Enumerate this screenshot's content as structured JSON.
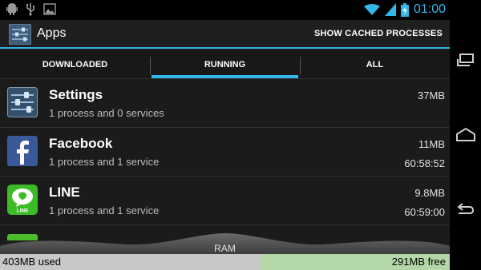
{
  "status_bar": {
    "time": "01:00",
    "icons": [
      "android-debug-icon",
      "usb-icon",
      "image-icon",
      "wifi-icon",
      "signal-icon",
      "battery-charging-icon"
    ]
  },
  "action_bar": {
    "title": "Apps",
    "action_label": "SHOW CACHED PROCESSES"
  },
  "tabs": [
    {
      "label": "DOWNLOADED",
      "active": false
    },
    {
      "label": "RUNNING",
      "active": true
    },
    {
      "label": "ALL",
      "active": false
    }
  ],
  "processes": [
    {
      "name": "Settings",
      "detail": "1 process and 0 services",
      "size": "37MB",
      "time": "",
      "icon": "settings-icon"
    },
    {
      "name": "Facebook",
      "detail": "1 process and 1 service",
      "size": "11MB",
      "time": "60:58:52",
      "icon": "facebook-icon"
    },
    {
      "name": "LINE",
      "detail": "1 process and 1 service",
      "size": "9.8MB",
      "time": "60:59:00",
      "icon": "line-icon"
    }
  ],
  "ram": {
    "label": "RAM",
    "used": "403MB used",
    "free": "291MB free"
  },
  "colors": {
    "accent": "#33b5e5",
    "ram_used": "#c8c8c8",
    "ram_free": "#b4d7a8"
  },
  "nav": [
    "recent-apps-icon",
    "home-icon",
    "back-icon"
  ]
}
